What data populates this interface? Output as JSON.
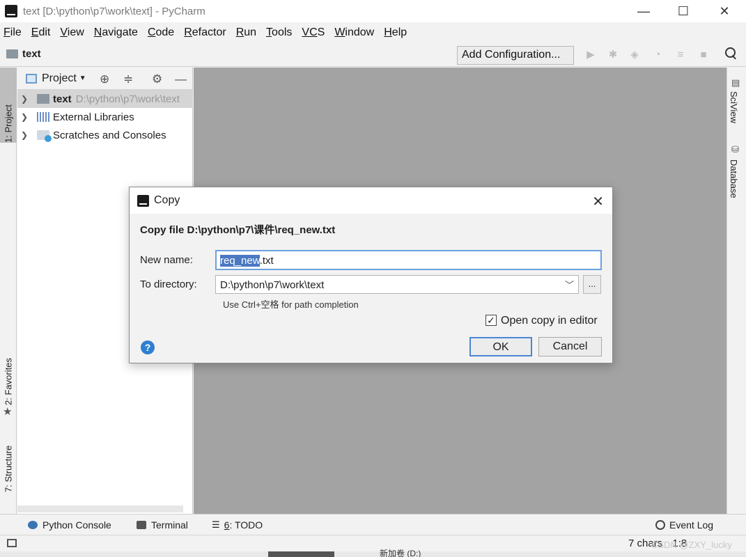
{
  "window": {
    "title": "text [D:\\python\\p7\\work\\text] - PyCharm",
    "controls": {
      "minimize": "—",
      "maximize": "☐",
      "close": "✕"
    }
  },
  "menu": [
    {
      "key": "F",
      "rest": "ile"
    },
    {
      "key": "E",
      "rest": "dit"
    },
    {
      "key": "V",
      "rest": "iew"
    },
    {
      "key": "N",
      "rest": "avigate"
    },
    {
      "key": "C",
      "rest": "ode"
    },
    {
      "key": "R",
      "rest": "efactor"
    },
    {
      "key": "R",
      "rest": "un"
    },
    {
      "key": "T",
      "rest": "ools"
    },
    {
      "key": "VC",
      "rest": "S"
    },
    {
      "key": "W",
      "rest": "indow"
    },
    {
      "key": "H",
      "rest": "elp"
    }
  ],
  "navbar": {
    "breadcrumb": "text",
    "add_configuration": "Add Configuration...",
    "toolbar_icons": [
      "run-icon",
      "debug-icon",
      "coverage-icon",
      "profile-icon",
      "concurrency-icon",
      "stop-icon",
      "search-icon"
    ]
  },
  "left_strip": {
    "project_tab": "1: Project",
    "favorites_tab": "2: Favorites",
    "structure_tab": "7: Structure"
  },
  "project_panel": {
    "header": "Project",
    "tree": [
      {
        "label": "text",
        "path": "D:\\python\\p7\\work\\text"
      },
      {
        "label": "External Libraries"
      },
      {
        "label": "Scratches and Consoles"
      }
    ]
  },
  "right_strip": {
    "sciview_tab": "SciView",
    "database_tab": "Database"
  },
  "bottom_tools": {
    "python_console": "Python Console",
    "terminal": "Terminal",
    "todo_key": "6",
    "todo_rest": ": TODO",
    "event_log": "Event Log"
  },
  "status_bar": {
    "chars": "7 chars",
    "position": "1:8",
    "watermark": "CSDN @ZXY_lucky"
  },
  "taskbar_fragment": "新加卷 (D:)",
  "dialog": {
    "title": "Copy",
    "heading": "Copy file D:\\python\\p7\\课件\\req_new.txt",
    "new_name_label": "New name:",
    "new_name_selected": "req_new",
    "new_name_rest": ".txt",
    "to_directory_label": "To directory:",
    "to_directory_value": "D:\\python\\p7\\work\\text",
    "browse_label": "...",
    "hint": "Use Ctrl+空格 for path completion",
    "open_in_editor_label": "Open copy in editor",
    "open_in_editor_checked": true,
    "ok_label": "OK",
    "cancel_label": "Cancel",
    "help_label": "?"
  }
}
